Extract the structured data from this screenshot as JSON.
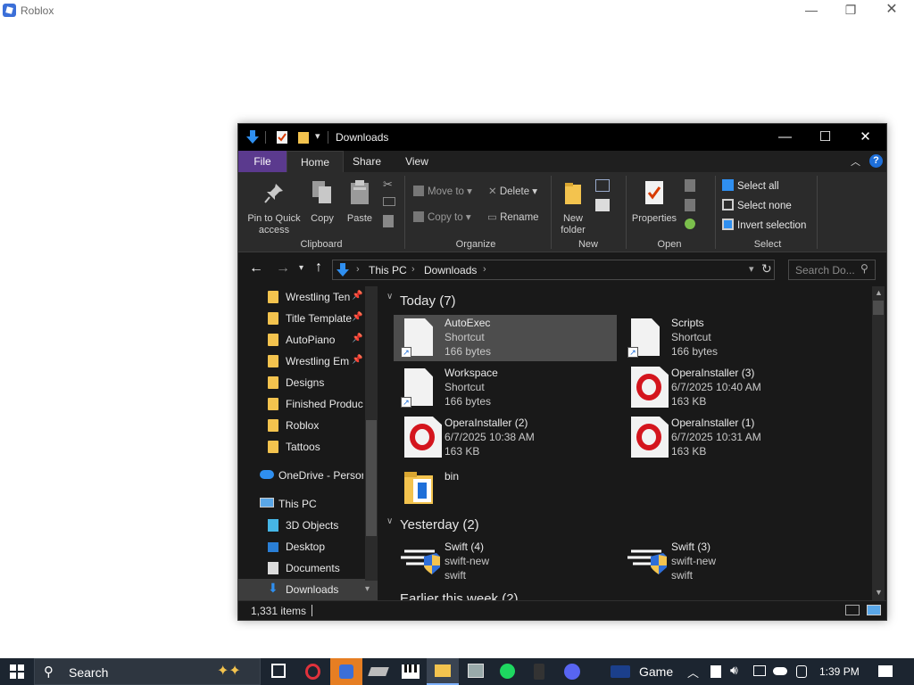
{
  "host_window": {
    "title": "Roblox",
    "minimize": "—",
    "restore": "❐",
    "close": "✕"
  },
  "explorer": {
    "title": "Downloads",
    "controls": {
      "minimize": "—",
      "maximize": "☐",
      "close": "✕"
    },
    "tabs": [
      {
        "label": "File"
      },
      {
        "label": "Home"
      },
      {
        "label": "Share"
      },
      {
        "label": "View"
      }
    ],
    "ribbon": {
      "clipboard": {
        "group_label": "Clipboard",
        "pin_label": "Pin to Quick access",
        "copy_label": "Copy",
        "paste_label": "Paste"
      },
      "organize": {
        "group_label": "Organize",
        "move_to": "Move to",
        "copy_to": "Copy to",
        "delete": "Delete",
        "rename": "Rename"
      },
      "new": {
        "group_label": "New",
        "new_folder": "New folder"
      },
      "open": {
        "group_label": "Open",
        "properties": "Properties"
      },
      "select": {
        "group_label": "Select",
        "select_all": "Select all",
        "select_none": "Select none",
        "invert_selection": "Invert selection"
      }
    },
    "address": {
      "segments": [
        "This PC",
        "Downloads"
      ],
      "search_placeholder": "Search Do..."
    },
    "nav_pane": {
      "quick_access": [
        {
          "label": "Wrestling Ten",
          "pinned": true
        },
        {
          "label": "Title Template",
          "pinned": true
        },
        {
          "label": "AutoPiano",
          "pinned": true
        },
        {
          "label": "Wrestling Em",
          "pinned": true
        },
        {
          "label": "Designs",
          "pinned": false
        },
        {
          "label": "Finished Produc",
          "pinned": false
        },
        {
          "label": "Roblox",
          "pinned": false
        },
        {
          "label": "Tattoos",
          "pinned": false
        }
      ],
      "onedrive": "OneDrive - Persor",
      "this_pc": "This PC",
      "this_pc_items": [
        "3D Objects",
        "Desktop",
        "Documents",
        "Downloads"
      ]
    },
    "content": {
      "groups": [
        {
          "header": "Today (7)",
          "items": [
            {
              "name": "AutoExec",
              "line2": "Shortcut",
              "line3": "166 bytes",
              "icon": "shortcut-icon",
              "selected": true
            },
            {
              "name": "Scripts",
              "line2": "Shortcut",
              "line3": "166 bytes",
              "icon": "shortcut-icon"
            },
            {
              "name": "Workspace",
              "line2": "Shortcut",
              "line3": "166 bytes",
              "icon": "shortcut-icon"
            },
            {
              "name": "OperaInstaller (3)",
              "line2": "6/7/2025 10:40 AM",
              "line3": "163 KB",
              "icon": "opera-icon"
            },
            {
              "name": "OperaInstaller (2)",
              "line2": "6/7/2025 10:38 AM",
              "line3": "163 KB",
              "icon": "opera-icon"
            },
            {
              "name": "OperaInstaller (1)",
              "line2": "6/7/2025 10:31 AM",
              "line3": "163 KB",
              "icon": "opera-icon"
            },
            {
              "name": "bin",
              "line2": "",
              "line3": "",
              "icon": "folder-icon"
            }
          ]
        },
        {
          "header": "Yesterday (2)",
          "items": [
            {
              "name": "Swift (4)",
              "line2": "swift-new",
              "line3": "swift",
              "icon": "swift-icon"
            },
            {
              "name": "Swift (3)",
              "line2": "swift-new",
              "line3": "swift",
              "icon": "swift-icon"
            }
          ]
        },
        {
          "header": "Earlier this week (2)"
        }
      ]
    },
    "status": {
      "item_count": "1,331 items"
    }
  },
  "taskbar": {
    "search_label": "Search",
    "widget_label": "Game",
    "time": "1:39 PM"
  },
  "colors": {
    "file_tab": "#5b3a8e",
    "accent_blue": "#1e6fd9",
    "folder": "#f3c34e",
    "opera_red": "#d4151d"
  }
}
